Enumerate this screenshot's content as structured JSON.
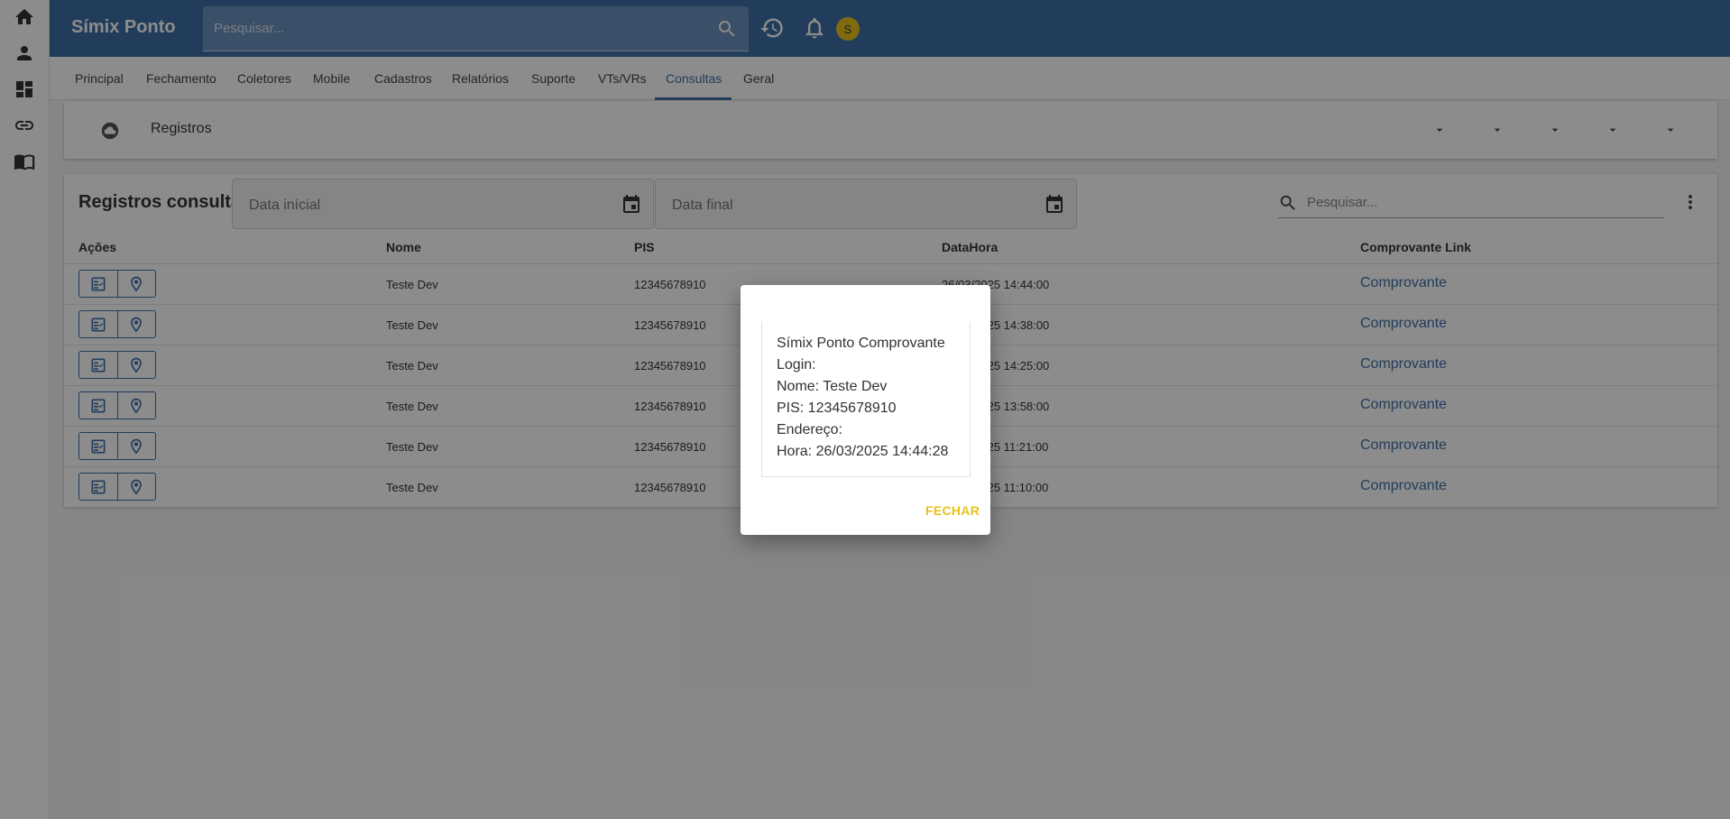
{
  "app": {
    "title": "Símix Ponto",
    "search_placeholder": "Pesquisar...",
    "avatar_initial": "S"
  },
  "rail": [
    "home-icon",
    "person-icon",
    "dashboard-icon",
    "link-icon",
    "book-icon"
  ],
  "tabs": [
    {
      "label": "Principal"
    },
    {
      "label": "Fechamento"
    },
    {
      "label": "Coletores"
    },
    {
      "label": "Mobile"
    },
    {
      "label": "Cadastros"
    },
    {
      "label": "Relatórios"
    },
    {
      "label": "Suporte"
    },
    {
      "label": "VTs/VRs"
    },
    {
      "label": "Consultas",
      "active": true
    },
    {
      "label": "Geral"
    }
  ],
  "registros_card": {
    "label": "Registros"
  },
  "table": {
    "title": "Registros consulta",
    "date_start_placeholder": "Data inícial",
    "date_end_placeholder": "Data final",
    "search_placeholder": "Pesquisar...",
    "columns": [
      "Ações",
      "Nome",
      "PIS",
      "DataHora",
      "Comprovante Link"
    ],
    "rows": [
      {
        "nome": "Teste Dev",
        "pis": "12345678910",
        "datahora": "26/03/2025 14:44:00",
        "link": "Comprovante"
      },
      {
        "nome": "Teste Dev",
        "pis": "12345678910",
        "datahora": "26/03/2025 14:38:00",
        "link": "Comprovante"
      },
      {
        "nome": "Teste Dev",
        "pis": "12345678910",
        "datahora": "26/03/2025 14:25:00",
        "link": "Comprovante"
      },
      {
        "nome": "Teste Dev",
        "pis": "12345678910",
        "datahora": "26/03/2025 13:58:00",
        "link": "Comprovante"
      },
      {
        "nome": "Teste Dev",
        "pis": "12345678910",
        "datahora": "26/03/2025 11:21:00",
        "link": "Comprovante"
      },
      {
        "nome": "Teste Dev",
        "pis": "12345678910",
        "datahora": "26/03/2025 11:10:00",
        "link": "Comprovante"
      }
    ]
  },
  "dialog": {
    "lines": [
      "Símix Ponto Comprovante",
      "Login:",
      "Nome: Teste Dev",
      "PIS: 12345678910",
      "Endereço:",
      "Hora: 26/03/2025 14:44:28"
    ],
    "close_label": "FECHAR"
  },
  "colors": {
    "primary": "#3f6fa6",
    "accent": "#e6c21a"
  }
}
